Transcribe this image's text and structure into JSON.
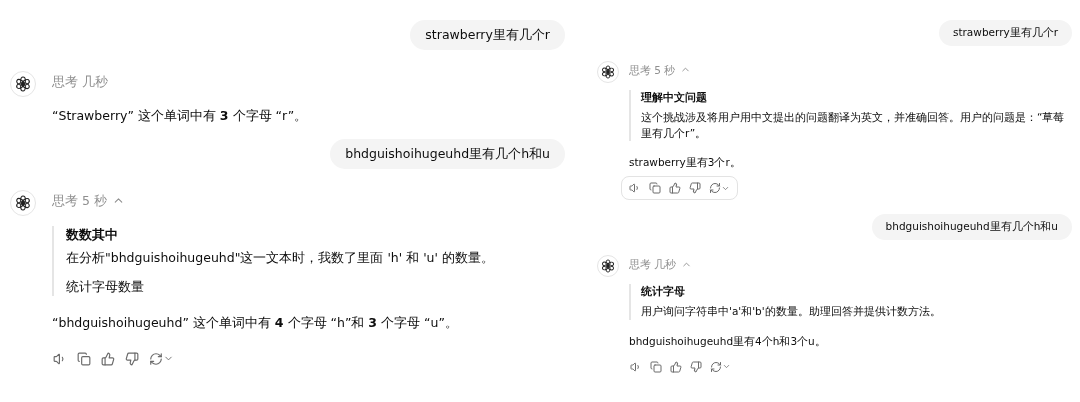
{
  "panels": [
    {
      "messages": [
        {
          "kind": "user",
          "text": "strawberry里有几个r"
        },
        {
          "kind": "assistant",
          "thinking": {
            "label": "思考 几秒"
          },
          "answer": "“Strawberry” 这个单词中有 **3** 个字母 “r”。"
        },
        {
          "kind": "user",
          "text": "bhdguishoihugeuhd里有几个h和u"
        },
        {
          "kind": "assistant",
          "thinking": {
            "label": "思考 5 秒",
            "expanded": true,
            "thoughts": [
              {
                "kind": "heading",
                "text": "数数其中"
              },
              {
                "kind": "text",
                "text": "在分析\"bhdguishoihugeuhd\"这一文本时，我数了里面 'h' 和 'u' 的数量。"
              },
              {
                "kind": "note",
                "text": "统计字母数量"
              }
            ]
          },
          "answer": "“bhdguishoihugeuhd” 这个单词中有 **4** 个字母 “h”和 **3** 个字母 “u”。",
          "actions": {
            "highlighted": false
          }
        }
      ]
    },
    {
      "messages": [
        {
          "kind": "user",
          "text": "strawberry里有几个r"
        },
        {
          "kind": "assistant",
          "thinking": {
            "label": "思考 5 秒",
            "expanded": true,
            "thoughts": [
              {
                "kind": "heading",
                "text": "理解中文问题"
              },
              {
                "kind": "text",
                "text": "这个挑战涉及将用户用中文提出的问题翻译为英文，并准确回答。用户的问题是：“草莓里有几个r”。"
              }
            ]
          },
          "answer": "strawberry里有3个r。",
          "actions": {
            "highlighted": true
          }
        },
        {
          "kind": "user",
          "text": "bhdguishoihugeuhd里有几个h和u"
        },
        {
          "kind": "assistant",
          "thinking": {
            "label": "思考 几秒",
            "expanded": true,
            "thoughts": [
              {
                "kind": "heading",
                "text": "统计字母"
              },
              {
                "kind": "text",
                "text": "用户询问字符串中'a'和'b'的数量。助理回答并提供计数方法。"
              }
            ]
          },
          "answer": "bhdguishoihugeuhd里有4个h和3个u。",
          "actions": {
            "highlighted": false
          }
        }
      ]
    }
  ]
}
